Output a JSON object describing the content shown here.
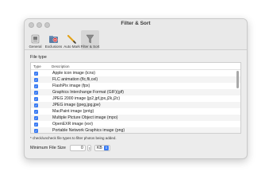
{
  "window": {
    "title": "Filter & Sort"
  },
  "toolbar": {
    "items": [
      {
        "label": "General"
      },
      {
        "label": "Exclusions"
      },
      {
        "label": "Auto Mark"
      },
      {
        "label": "Filter & Sort"
      }
    ]
  },
  "file_type": {
    "section_label": "File type",
    "columns": {
      "type": "Type",
      "description": "Description"
    },
    "rows": [
      "Apple icon image (icns)",
      "FLC animation (flc,fli,cel)",
      "FlashPix image (fpx)",
      "Graphics Interchange Format (GIF)(gif)",
      "JPEG 2000 image (jp2,jpf,jpx,j2k,j2c)",
      "JPEG image (jpeg,jpg,jpe)",
      "MacPaint image (pntg)",
      "Multiple Picture Object image (mpo)",
      "OpenEXR image (exr)",
      "Portable Network Graphics image (png)"
    ],
    "hint": "* check/uncheck file types to filter photos being added."
  },
  "min_size": {
    "label": "Minimum File Size",
    "value": "0",
    "unit": "KB"
  }
}
